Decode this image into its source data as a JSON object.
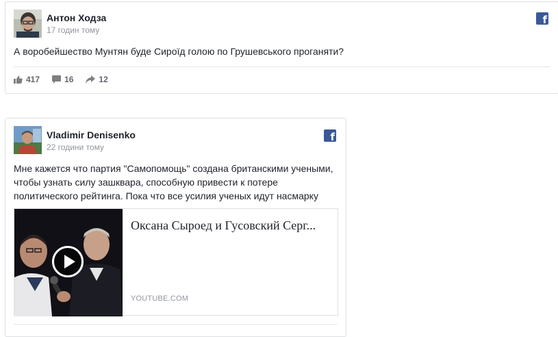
{
  "posts": [
    {
      "author": "Антон Ходза",
      "time": "17 годин тому",
      "text": "А воробейшество Мунтян буде Сироїд голою по Грушевського проганяти?",
      "actions": {
        "likes": "417",
        "comments": "16",
        "shares": "12"
      },
      "source_icon": "facebook-icon"
    },
    {
      "author": "Vladimir Denisenko",
      "time": "22 години тому",
      "text_lines": [
        "Мне кажется что партия \"Самопомощь\" создана британскими учеными,",
        "чтобы узнать силу зашквара, способную привести к потере",
        "политического рейтинга. Пока что все усилия ученых идут насмарку"
      ],
      "link": {
        "title": "Оксана Сыроед и Гусовский Серг...",
        "domain": "YOUTUBE.COM"
      },
      "source_icon": "facebook-icon"
    }
  ],
  "colors": {
    "facebook_blue": "#3b5998",
    "meta_gray": "#90949c",
    "action_gray": "#616770",
    "border": "#dddfe2"
  }
}
